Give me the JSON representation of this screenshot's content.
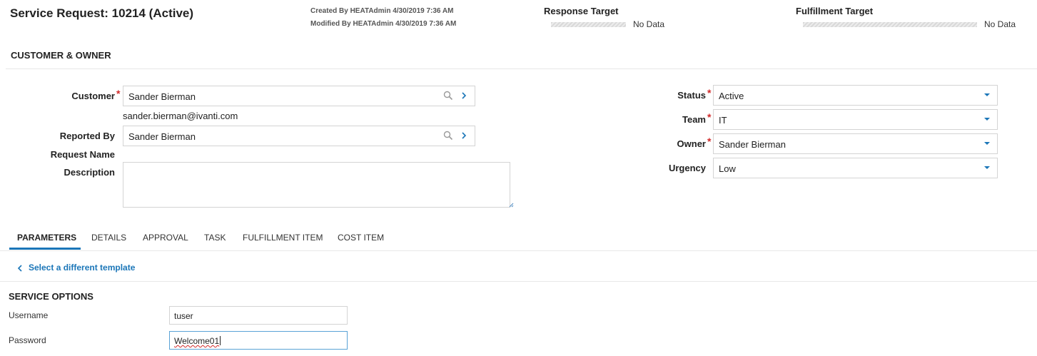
{
  "header": {
    "title": "Service Request: 10214 (Active)",
    "created": "Created By HEATAdmin 4/30/2019 7:36 AM",
    "modified": "Modified By HEATAdmin 4/30/2019 7:36 AM",
    "response_target": {
      "label": "Response Target",
      "value": "No Data"
    },
    "fulfillment_target": {
      "label": "Fulfillment Target",
      "value": "No Data"
    }
  },
  "customer_owner": {
    "section_title": "CUSTOMER & OWNER",
    "customer": {
      "label": "Customer",
      "value": "Sander Bierman",
      "email": "sander.bierman@ivanti.com"
    },
    "reported_by": {
      "label": "Reported By",
      "value": "Sander Bierman"
    },
    "request_name": {
      "label": "Request Name",
      "value": ""
    },
    "description": {
      "label": "Description",
      "value": ""
    },
    "status": {
      "label": "Status",
      "value": "Active"
    },
    "team": {
      "label": "Team",
      "value": "IT"
    },
    "owner": {
      "label": "Owner",
      "value": "Sander Bierman"
    },
    "urgency": {
      "label": "Urgency",
      "value": "Low"
    }
  },
  "tabs": [
    {
      "label": "PARAMETERS",
      "active": true
    },
    {
      "label": "DETAILS",
      "active": false
    },
    {
      "label": "APPROVAL",
      "active": false
    },
    {
      "label": "TASK",
      "active": false
    },
    {
      "label": "FULFILLMENT ITEM",
      "active": false
    },
    {
      "label": "COST ITEM",
      "active": false
    }
  ],
  "parameters": {
    "back_link": "Select a different template",
    "section_title": "SERVICE OPTIONS",
    "username": {
      "label": "Username",
      "value": "tuser"
    },
    "password": {
      "label": "Password",
      "value": "Welcome01"
    }
  },
  "colors": {
    "accent": "#1b76b8",
    "required": "#d12a2a",
    "border": "#d4d4d4"
  },
  "icons": {
    "search": "search-icon",
    "navigate": "chevron-right-icon",
    "dropdown": "caret-down-icon",
    "back": "chevron-left-icon"
  }
}
